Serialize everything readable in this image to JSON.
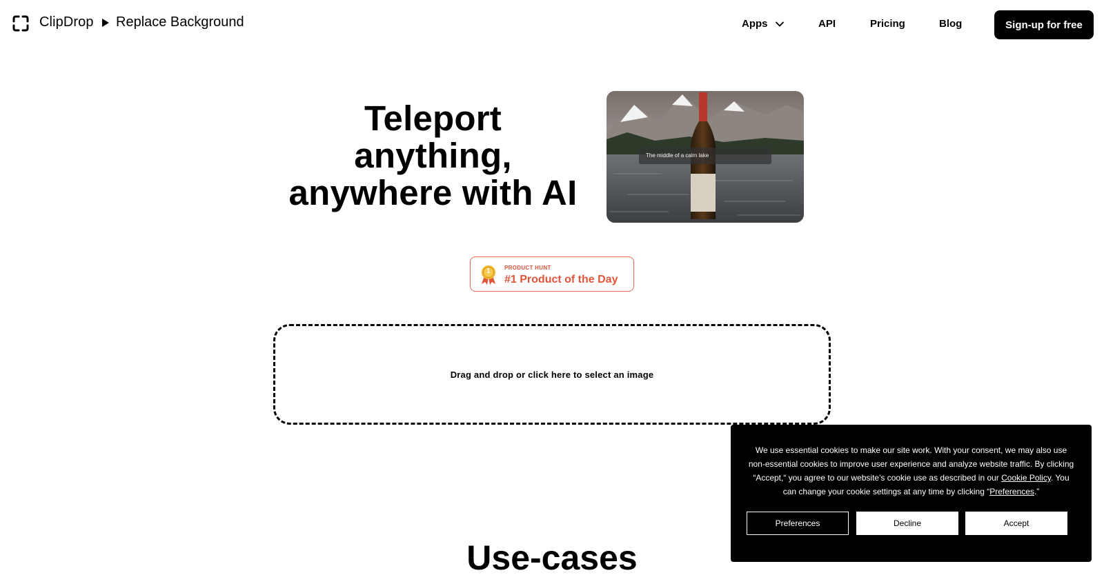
{
  "header": {
    "brand": "ClipDrop",
    "breadcrumb_page": "Replace Background",
    "nav": {
      "apps": "Apps",
      "api": "API",
      "pricing": "Pricing",
      "blog": "Blog"
    },
    "signup_label": "Sign-up for free"
  },
  "hero": {
    "title_line1": "Teleport",
    "title_line2": "anything,",
    "title_line3": "anywhere with AI",
    "image_caption": "The middle of a calm lake"
  },
  "badge": {
    "kicker": "PRODUCT HUNT",
    "title": "#1 Product of the Day",
    "medal_number": "1",
    "accent_color": "#e0553a"
  },
  "dropzone": {
    "label": "Drag and drop or click here to select an image"
  },
  "section": {
    "usecases_title": "Use-cases"
  },
  "cookie": {
    "text_1": "We use essential cookies to make our site work. With your consent, we may also use non-essential cookies to improve user experience and analyze website traffic. By clicking “Accept,“ you agree to our website's cookie use as described in our ",
    "cookie_policy_link": "Cookie Policy",
    "text_2": ". You can change your cookie settings at any time by clicking “",
    "preferences_link": "Preferences",
    "text_3": ".”",
    "btn_preferences": "Preferences",
    "btn_decline": "Decline",
    "btn_accept": "Accept"
  },
  "icons": {
    "logo": "clipdrop-logo-icon",
    "breadcrumb": "play-triangle-icon",
    "apps_dropdown": "chevron-down-icon",
    "badge": "medal-icon"
  }
}
